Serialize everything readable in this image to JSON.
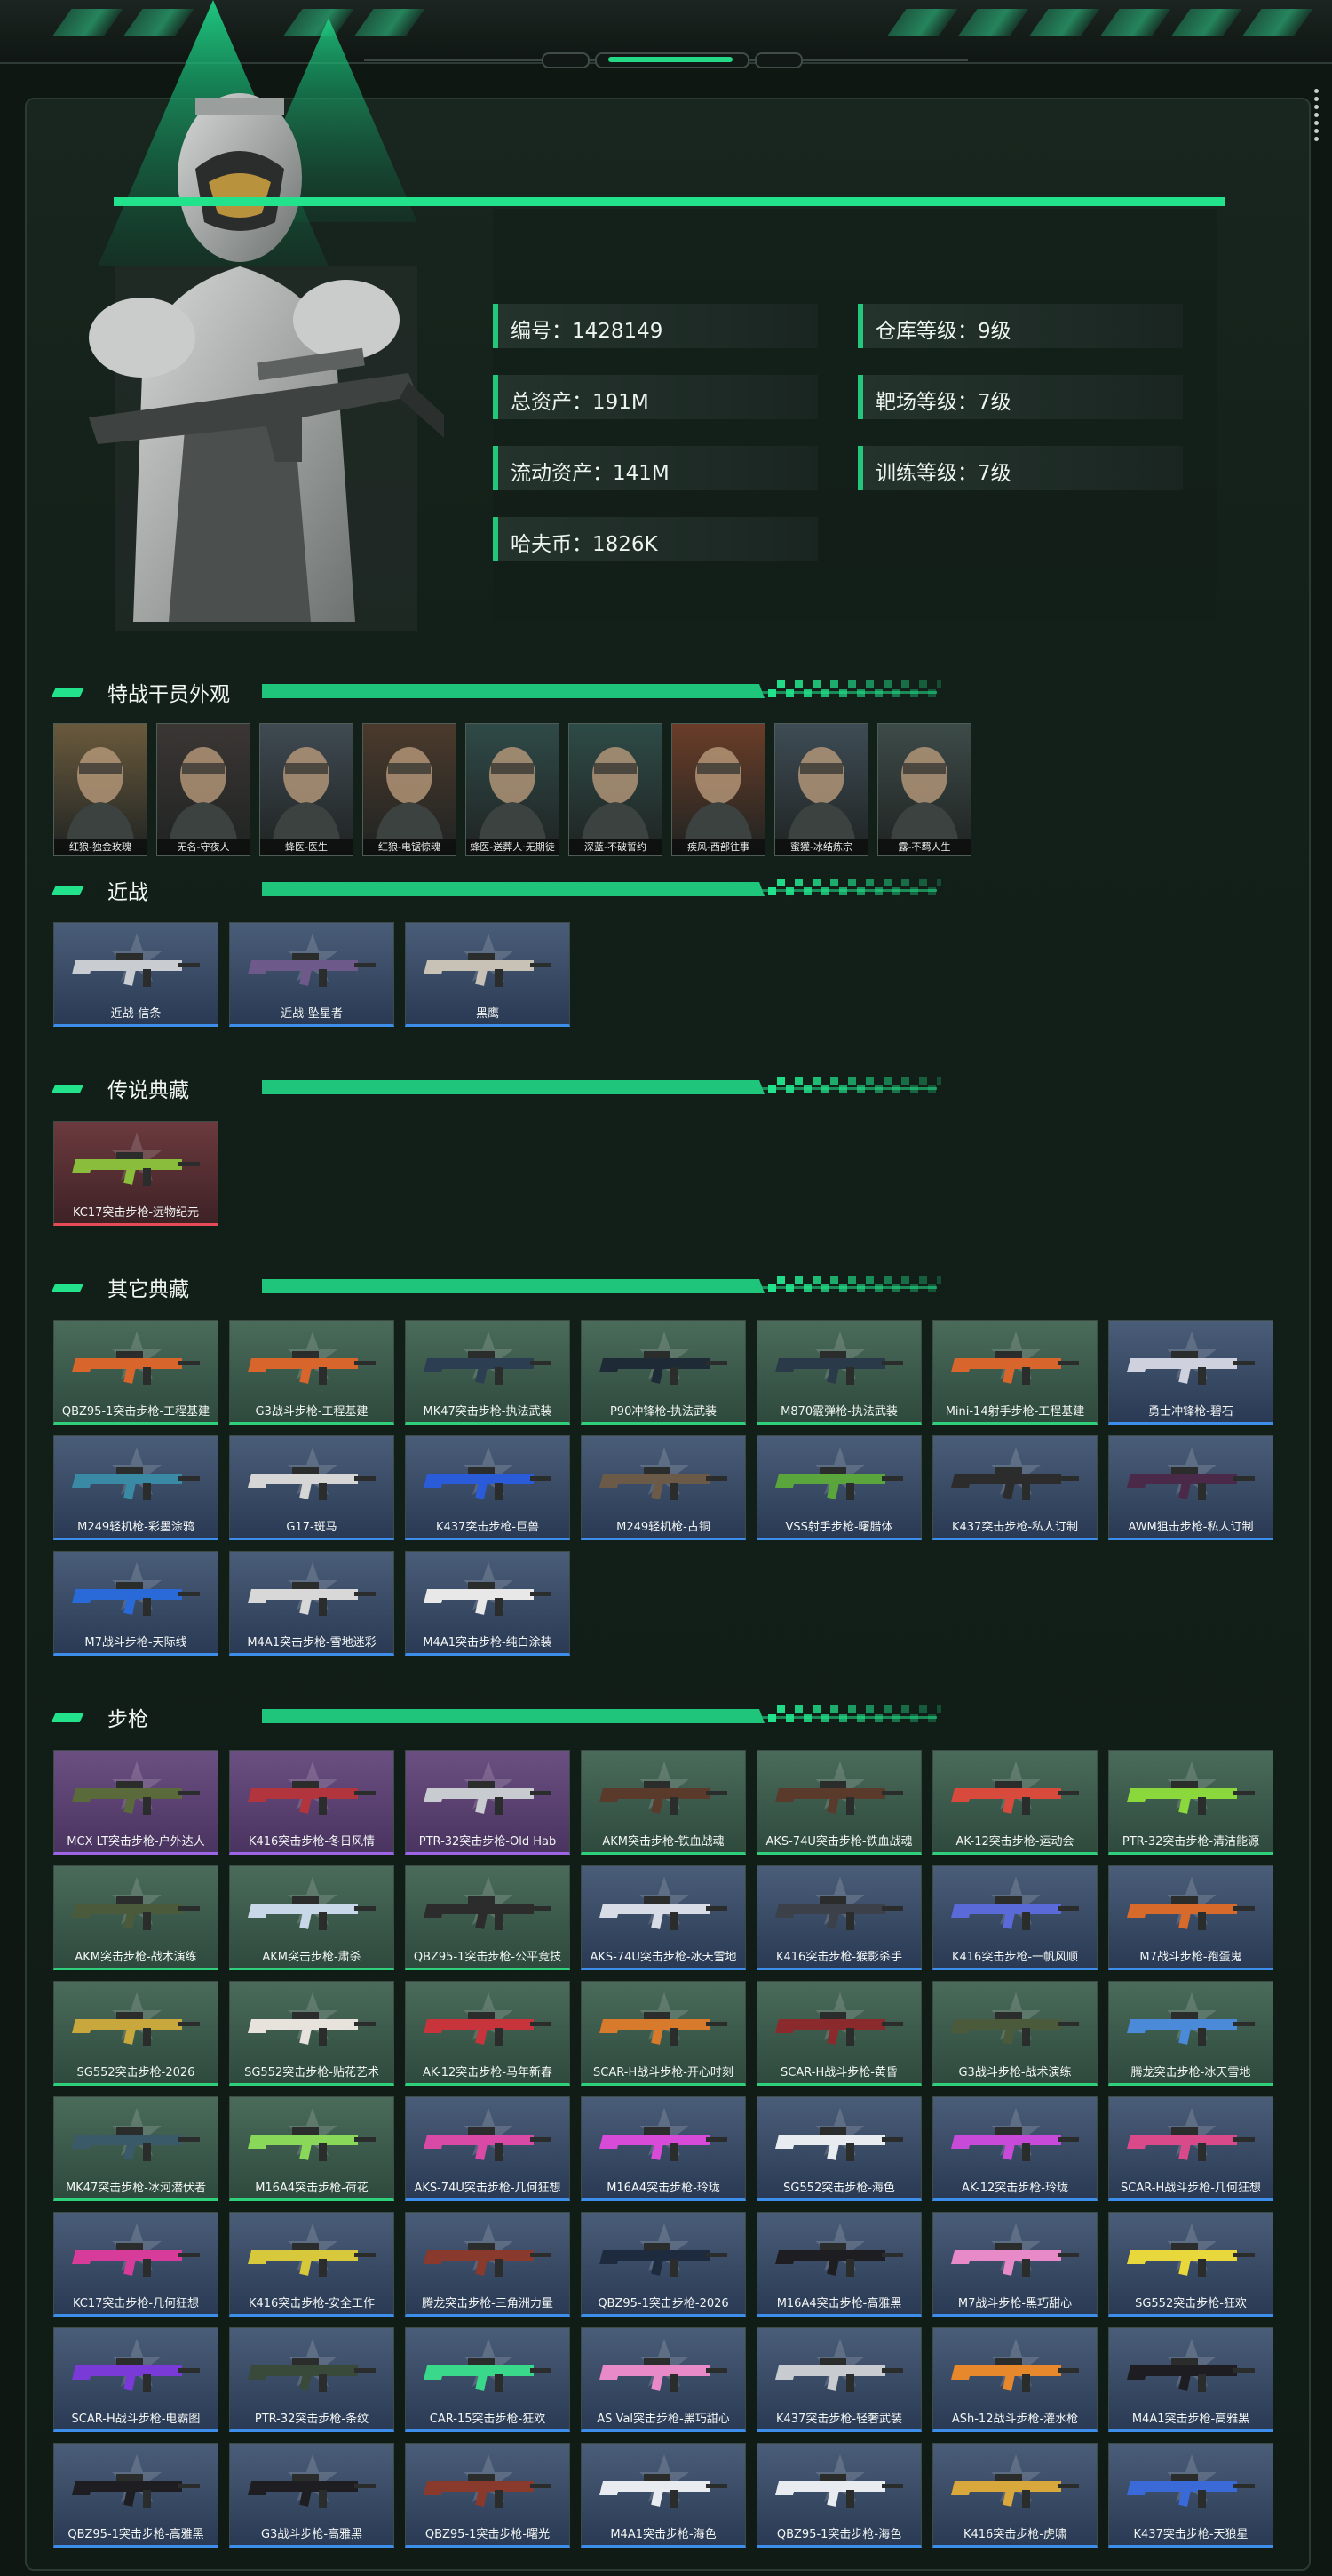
{
  "profile": {
    "stats": [
      {
        "text": "编号：1428149"
      },
      {
        "text": "仓库等级：9级"
      },
      {
        "text": "总资产：191M"
      },
      {
        "text": "靶场等级：7级"
      },
      {
        "text": "流动资产：141M"
      },
      {
        "text": "训练等级：7级"
      },
      {
        "text": "哈夫币：1826K"
      }
    ]
  },
  "sections": {
    "operators": {
      "title": "特战干员外观",
      "items": [
        {
          "label": "红狼-独金玫瑰",
          "color": "#6a5a3c"
        },
        {
          "label": "无名-守夜人",
          "color": "#3b3634"
        },
        {
          "label": "蜂医-医生",
          "color": "#3f4a52"
        },
        {
          "label": "红狼-电锯惊魂",
          "color": "#4b3a2c"
        },
        {
          "label": "蜂医-送葬人·无期徒",
          "color": "#2f4a48"
        },
        {
          "label": "深蓝-不破誓约",
          "color": "#2e4b47"
        },
        {
          "label": "疾风-西部往事",
          "color": "#6a3d28"
        },
        {
          "label": "蜜獾-冰结炼宗",
          "color": "#3e4c55"
        },
        {
          "label": "露-不羁人生",
          "color": "#3d4b48"
        }
      ]
    },
    "melee": {
      "title": "近战",
      "items": [
        {
          "label": "近战-信条",
          "rarity": "blue",
          "gun": "#c9ccd0"
        },
        {
          "label": "近战-坠星者",
          "rarity": "blue",
          "gun": "#6e5a8a"
        },
        {
          "label": "黑鹰",
          "rarity": "blue",
          "gun": "#c8c2b6"
        }
      ]
    },
    "legendary": {
      "title": "传说典藏",
      "items": [
        {
          "label": "KC17突击步枪-远物纪元",
          "rarity": "red",
          "gun": "#8bbd3c"
        }
      ]
    },
    "other": {
      "title": "其它典藏",
      "items": [
        {
          "label": "QBZ95-1突击步枪-工程基建",
          "rarity": "green",
          "gun": "#d8652c"
        },
        {
          "label": "G3战斗步枪-工程基建",
          "rarity": "green",
          "gun": "#d8652c"
        },
        {
          "label": "MK47突击步枪-执法武装",
          "rarity": "green",
          "gun": "#2c3e52"
        },
        {
          "label": "P90冲锋枪-执法武装",
          "rarity": "green",
          "gun": "#1e2a36"
        },
        {
          "label": "M870霰弹枪-执法武装",
          "rarity": "green",
          "gun": "#2a3a48"
        },
        {
          "label": "Mini-14射手步枪-工程基建",
          "rarity": "green",
          "gun": "#d8652c"
        },
        {
          "label": "勇士冲锋枪-碧石",
          "rarity": "blue",
          "gun": "#cfd2de"
        },
        {
          "label": "M249轻机枪-彩墨涂鸦",
          "rarity": "blue",
          "gun": "#3a8aa6"
        },
        {
          "label": "G17-斑马",
          "rarity": "blue",
          "gun": "#d6d6d6"
        },
        {
          "label": "K437突击步枪-巨兽",
          "rarity": "blue",
          "gun": "#2a5bd8"
        },
        {
          "label": "M249轻机枪-古铜",
          "rarity": "blue",
          "gun": "#6b5a48"
        },
        {
          "label": "VSS射手步枪-曙腊体",
          "rarity": "blue",
          "gun": "#5aa63c"
        },
        {
          "label": "K437突击步枪-私人订制",
          "rarity": "blue",
          "gun": "#2c2c2c"
        },
        {
          "label": "AWM狙击步枪-私人订制",
          "rarity": "blue",
          "gun": "#4a2a48"
        },
        {
          "label": "M7战斗步枪-天际线",
          "rarity": "blue",
          "gun": "#2a6ad8"
        },
        {
          "label": "M4A1突击步枪-雪地迷彩",
          "rarity": "blue",
          "gun": "#d8d8d8"
        },
        {
          "label": "M4A1突击步枪-纯白涂装",
          "rarity": "blue",
          "gun": "#e8e8e8"
        }
      ]
    },
    "rifles": {
      "title": "步枪",
      "items": [
        {
          "label": "MCX LT突击步枪-户外达人",
          "rarity": "purple",
          "gun": "#5a6a3a"
        },
        {
          "label": "K416突击步枪-冬日风情",
          "rarity": "purple",
          "gun": "#b2343c"
        },
        {
          "label": "PTR-32突击步枪-Old Hab",
          "rarity": "purple",
          "gun": "#c8ccd0"
        },
        {
          "label": "AKM突击步枪-铁血战魂",
          "rarity": "green",
          "gun": "#5a3a2a"
        },
        {
          "label": "AKS-74U突击步枪-铁血战魂",
          "rarity": "green",
          "gun": "#5a3a2a"
        },
        {
          "label": "AK-12突击步枪-运动会",
          "rarity": "green",
          "gun": "#d84a3c"
        },
        {
          "label": "PTR-32突击步枪-清洁能源",
          "rarity": "green",
          "gun": "#8ad83c"
        },
        {
          "label": "AKM突击步枪-战术演练",
          "rarity": "green",
          "gun": "#4a5a3a"
        },
        {
          "label": "AKM突击步枪-肃杀",
          "rarity": "green",
          "gun": "#c8d8e8"
        },
        {
          "label": "QBZ95-1突击步枪-公平竞技",
          "rarity": "green",
          "gun": "#2c2c2c"
        },
        {
          "label": "AKS-74U突击步枪-冰天雪地",
          "rarity": "blue",
          "gun": "#d8dce6"
        },
        {
          "label": "K416突击步枪-猴影杀手",
          "rarity": "blue",
          "gun": "#3c4048"
        },
        {
          "label": "K416突击步枪-一帆风顺",
          "rarity": "blue",
          "gun": "#5a6ad8"
        },
        {
          "label": "M7战斗步枪-孢蛋鬼",
          "rarity": "blue",
          "gun": "#d86a2c"
        },
        {
          "label": "SG552突击步枪-2026",
          "rarity": "green",
          "gun": "#c8a83c"
        },
        {
          "label": "SG552突击步枪-贴花艺术",
          "rarity": "green",
          "gun": "#e8e2dc"
        },
        {
          "label": "AK-12突击步枪-马年新春",
          "rarity": "green",
          "gun": "#c8343c"
        },
        {
          "label": "SCAR-H战斗步枪-开心时刻",
          "rarity": "green",
          "gun": "#d87a2c"
        },
        {
          "label": "SCAR-H战斗步枪-黄昏",
          "rarity": "green",
          "gun": "#8a2a2c"
        },
        {
          "label": "G3战斗步枪-战术演练",
          "rarity": "green",
          "gun": "#4a5a3a"
        },
        {
          "label": "腾龙突击步枪-冰天雪地",
          "rarity": "green",
          "gun": "#4a8ad8"
        },
        {
          "label": "MK47突击步枪-冰河潜伏者",
          "rarity": "green",
          "gun": "#3a5a6a"
        },
        {
          "label": "M16A4突击步枪-荷花",
          "rarity": "green",
          "gun": "#8ad85a"
        },
        {
          "label": "AKS-74U突击步枪-几何狂想",
          "rarity": "blue",
          "gun": "#d84aa6"
        },
        {
          "label": "M16A4突击步枪-玲珑",
          "rarity": "blue",
          "gun": "#d84ad8"
        },
        {
          "label": "SG552突击步枪-海色",
          "rarity": "blue",
          "gun": "#e8ecf0"
        },
        {
          "label": "AK-12突击步枪-玲珑",
          "rarity": "blue",
          "gun": "#c84ad8"
        },
        {
          "label": "SCAR-H战斗步枪-几何狂想",
          "rarity": "blue",
          "gun": "#d84a8a"
        },
        {
          "label": "KC17突击步枪-几何狂想",
          "rarity": "blue",
          "gun": "#d83c9a"
        },
        {
          "label": "K416突击步枪-安全工作",
          "rarity": "blue",
          "gun": "#d8c83c"
        },
        {
          "label": "腾龙突击步枪-三角洲力量",
          "rarity": "blue",
          "gun": "#8a3a2c"
        },
        {
          "label": "QBZ95-1突击步枪-2026",
          "rarity": "blue",
          "gun": "#1e2a3e"
        },
        {
          "label": "M16A4突击步枪-高雅黑",
          "rarity": "blue",
          "gun": "#1e1e22"
        },
        {
          "label": "M7战斗步枪-黑巧甜心",
          "rarity": "blue",
          "gun": "#e88ac8"
        },
        {
          "label": "SG552突击步枪-狂欢",
          "rarity": "blue",
          "gun": "#e8d83c"
        },
        {
          "label": "SCAR-H战斗步枪-电霸图",
          "rarity": "blue",
          "gun": "#7a3ad8"
        },
        {
          "label": "PTR-32突击步枪-条纹",
          "rarity": "blue",
          "gun": "#3a4a3a"
        },
        {
          "label": "CAR-15突击步枪-狂欢",
          "rarity": "blue",
          "gun": "#3ad88a"
        },
        {
          "label": "AS Val突击步枪-黑巧甜心",
          "rarity": "blue",
          "gun": "#e88ac8"
        },
        {
          "label": "K437突击步枪-轻奢武装",
          "rarity": "blue",
          "gun": "#c8ccd0"
        },
        {
          "label": "ASh-12战斗步枪-灌水枪",
          "rarity": "blue",
          "gun": "#e8882c"
        },
        {
          "label": "M4A1突击步枪-高雅黑",
          "rarity": "blue",
          "gun": "#1e1e22"
        },
        {
          "label": "QBZ95-1突击步枪-高雅黑",
          "rarity": "blue",
          "gun": "#1e1e22"
        },
        {
          "label": "G3战斗步枪-高雅黑",
          "rarity": "blue",
          "gun": "#1e1e22"
        },
        {
          "label": "QBZ95-1突击步枪-曙光",
          "rarity": "blue",
          "gun": "#8a3a2c"
        },
        {
          "label": "M4A1突击步枪-海色",
          "rarity": "blue",
          "gun": "#e8ecf0"
        },
        {
          "label": "QBZ95-1突击步枪-海色",
          "rarity": "blue",
          "gun": "#e8ecf0"
        },
        {
          "label": "K416突击步枪-虎啸",
          "rarity": "blue",
          "gun": "#d8a83c"
        },
        {
          "label": "K437突击步枪-天狼星",
          "rarity": "blue",
          "gun": "#3a6ad8"
        }
      ]
    }
  },
  "colors": {
    "accent": "#22e38c",
    "panel": "#132019"
  }
}
